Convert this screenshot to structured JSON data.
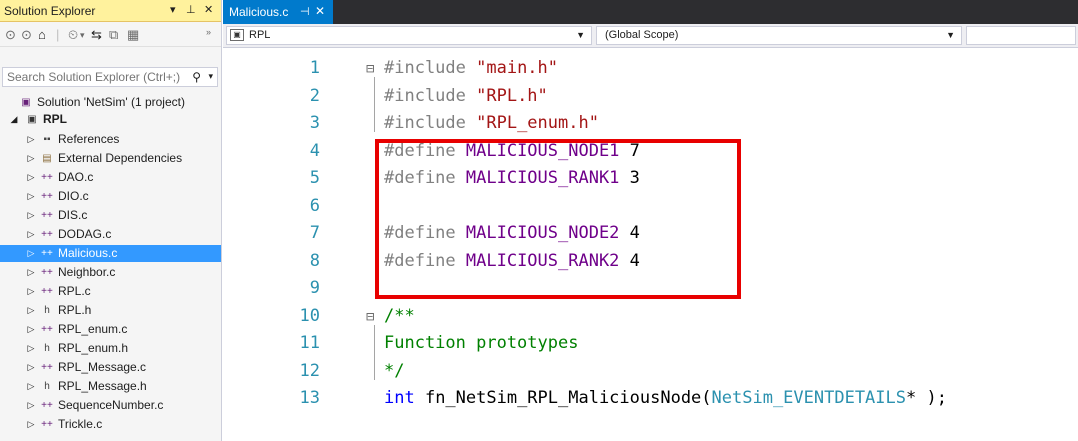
{
  "solution_explorer": {
    "title": "Solution Explorer",
    "pin_glyphs": "▾ ⊥ ✕",
    "search_placeholder": "Search Solution Explorer (Ctrl+;)",
    "solution_label": "Solution 'NetSim' (1 project)",
    "project_label": "RPL",
    "items": [
      {
        "label": "References",
        "icon": "references-icon"
      },
      {
        "label": "External Dependencies",
        "icon": "external-dependencies-icon"
      },
      {
        "label": "DAO.c",
        "icon": "c-file-icon"
      },
      {
        "label": "DIO.c",
        "icon": "c-file-icon"
      },
      {
        "label": "DIS.c",
        "icon": "c-file-icon"
      },
      {
        "label": "DODAG.c",
        "icon": "c-file-icon"
      },
      {
        "label": "Malicious.c",
        "icon": "c-file-icon",
        "selected": true
      },
      {
        "label": "Neighbor.c",
        "icon": "c-file-icon"
      },
      {
        "label": "RPL.c",
        "icon": "c-file-icon"
      },
      {
        "label": "RPL.h",
        "icon": "h-file-icon"
      },
      {
        "label": "RPL_enum.c",
        "icon": "c-file-icon"
      },
      {
        "label": "RPL_enum.h",
        "icon": "h-file-icon"
      },
      {
        "label": "RPL_Message.c",
        "icon": "c-file-icon"
      },
      {
        "label": "RPL_Message.h",
        "icon": "h-file-icon"
      },
      {
        "label": "SequenceNumber.c",
        "icon": "c-file-icon"
      },
      {
        "label": "Trickle.c",
        "icon": "c-file-icon"
      }
    ]
  },
  "editor": {
    "tab_label": "Malicious.c",
    "tab_pin": "⊣",
    "tab_close": "✕",
    "nav_project": "RPL",
    "nav_scope": "(Global Scope)",
    "lines": [
      {
        "n": "1",
        "fold": "⊟",
        "tokens": [
          [
            "pp",
            "#include "
          ],
          [
            "st",
            "\"main.h\""
          ]
        ]
      },
      {
        "n": "2",
        "tokens": [
          [
            "pp",
            "#include "
          ],
          [
            "st",
            "\"RPL.h\""
          ]
        ]
      },
      {
        "n": "3",
        "tokens": [
          [
            "pp",
            "#include "
          ],
          [
            "st",
            "\"RPL_enum.h\""
          ]
        ]
      },
      {
        "n": "4",
        "tokens": [
          [
            "pp",
            "#define "
          ],
          [
            "mc",
            "MALICIOUS_NODE1"
          ],
          [
            "nu",
            " 7"
          ]
        ]
      },
      {
        "n": "5",
        "tokens": [
          [
            "pp",
            "#define "
          ],
          [
            "mc",
            "MALICIOUS_RANK1"
          ],
          [
            "nu",
            " 3"
          ]
        ]
      },
      {
        "n": "6",
        "tokens": []
      },
      {
        "n": "7",
        "tokens": [
          [
            "pp",
            "#define "
          ],
          [
            "mc",
            "MALICIOUS_NODE2"
          ],
          [
            "nu",
            " 4"
          ]
        ]
      },
      {
        "n": "8",
        "tokens": [
          [
            "pp",
            "#define "
          ],
          [
            "mc",
            "MALICIOUS_RANK2"
          ],
          [
            "nu",
            " 4"
          ]
        ]
      },
      {
        "n": "9",
        "tokens": []
      },
      {
        "n": "10",
        "fold": "⊟",
        "tokens": [
          [
            "cm",
            "/**"
          ]
        ]
      },
      {
        "n": "11",
        "tokens": [
          [
            "cm",
            "Function prototypes"
          ]
        ]
      },
      {
        "n": "12",
        "tokens": [
          [
            "cm",
            "*/"
          ]
        ]
      },
      {
        "n": "13",
        "tokens": [
          [
            "kw",
            "int"
          ],
          [
            "pl",
            " fn_NetSim_RPL_MaliciousNode("
          ],
          [
            "ty",
            "NetSim_EVENTDETAILS"
          ],
          [
            "pl",
            "* );"
          ]
        ]
      }
    ]
  },
  "colors": {
    "selection": "#3399ff",
    "tab_active": "#007acc",
    "highlight_box": "#e80000",
    "title_bar": "#fff29d"
  }
}
